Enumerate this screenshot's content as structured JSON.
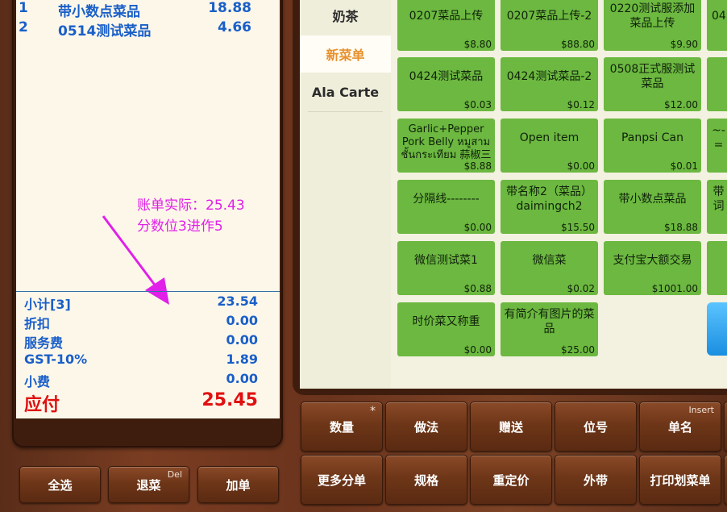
{
  "order": {
    "items": [
      {
        "idx": "1",
        "name": "带小数点菜品",
        "price": "18.88"
      },
      {
        "idx": "2",
        "name": "0514测试菜品",
        "price": "4.66"
      }
    ]
  },
  "annotation": {
    "line1": "账单实际：25.43",
    "line2": "分数位3进作5",
    "color": "#e020e8"
  },
  "summary": {
    "subtotal_label": "小计[3]",
    "subtotal": "23.54",
    "discount_label": "折扣",
    "discount": "0.00",
    "service_label": "服务费",
    "service": "0.00",
    "gst_label": "GST-10%",
    "gst": "1.89",
    "tip_label": "小费",
    "tip": "0.00",
    "due_label": "应付",
    "due": "25.45"
  },
  "left_buttons": {
    "select_all": "全选",
    "return_dish": "退菜",
    "return_hotkey": "Del",
    "add_dish": "加单"
  },
  "categories": [
    {
      "label": "奶茶"
    },
    {
      "label": "新菜单",
      "active": true
    },
    {
      "label": "Ala Carte"
    }
  ],
  "dishes": [
    {
      "name": "0207菜品上传",
      "price": "$8.80"
    },
    {
      "name": "0207菜品上传-2",
      "price": "$88.80"
    },
    {
      "name": "0220测试服添加菜品上传",
      "price": "$9.90"
    },
    {
      "name": "0424测试菜品",
      "price": "$0.03"
    },
    {
      "name": "0424测试菜品-2",
      "price": "$0.12"
    },
    {
      "name": "0508正式服测试菜品",
      "price": "$12.00"
    },
    {
      "name": "Garlic+Pepper Pork Belly หมูสามชั้นกระเทียม 蒜椒三",
      "price": "$8.88"
    },
    {
      "name": "Open item",
      "price": "$0.00"
    },
    {
      "name": "Panpsi Can",
      "price": "$0.01"
    },
    {
      "name": "分隔线--------",
      "price": "$0.00"
    },
    {
      "name": "带名称2（菜品）daimingch2",
      "price": "$15.50"
    },
    {
      "name": "带小数点菜品",
      "price": "$18.88"
    },
    {
      "name": "微信测试菜1",
      "price": "$0.88"
    },
    {
      "name": "微信菜",
      "price": "$0.02"
    },
    {
      "name": "支付宝大额交易",
      "price": "$1001.00"
    },
    {
      "name": "时价菜又称重",
      "price": "$0.00"
    },
    {
      "name": "有简介有图片的菜品",
      "price": "$25.00"
    }
  ],
  "partial_dishes": [
    "04",
    "",
    "~-=",
    "",
    "带词",
    ""
  ],
  "bottom_buttons": {
    "row1": [
      {
        "label": "数量",
        "sup": "*"
      },
      {
        "label": "做法",
        "sup": ""
      },
      {
        "label": "赠送",
        "sup": ""
      },
      {
        "label": "位号",
        "sup": ""
      },
      {
        "label": "单名",
        "sup": "Insert"
      }
    ],
    "row2": [
      {
        "label": "更多分单"
      },
      {
        "label": "规格"
      },
      {
        "label": "重定价"
      },
      {
        "label": "外带"
      },
      {
        "label": "打印划菜单"
      }
    ]
  }
}
